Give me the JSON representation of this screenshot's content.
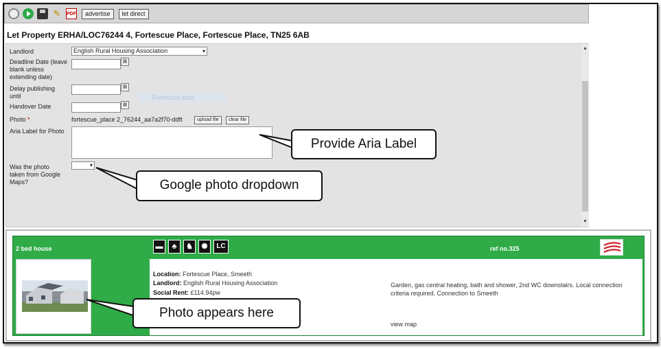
{
  "toolbar": {
    "icons": [
      "back-circle-icon",
      "go-icon",
      "save-icon",
      "edit-icon",
      "pdf-icon"
    ],
    "advertise_label": "advertise",
    "let_direct_label": "let direct"
  },
  "page_title": "Let  Property ERHA/LOC76244 4, Fortescue Place, Fortescue Place, TN25 6AB",
  "form": {
    "landlord_label": "Landlord",
    "landlord_value": "English Rural Housing Association",
    "deadline_label_lines": [
      "Deadline Date (leave",
      "blank unless",
      "extending date)"
    ],
    "delay_label_lines": [
      "Delay publishing",
      "until"
    ],
    "handover_label": "Handover Date",
    "ghost_tag": "Fortescue local",
    "photo_label": "Photo",
    "photo_required": "*",
    "photo_filename": "fortescue_place 2_76244_aa7a2f70-ddft",
    "upload_label": "upload file",
    "clear_label": "clear file",
    "aria_label": "Aria Label for Photo",
    "google_label_lines": [
      "Was the photo",
      "taken from Google",
      "Maps?"
    ]
  },
  "callouts": {
    "aria": "Provide Aria Label",
    "google": "Google photo dropdown",
    "photo": "Photo appears here"
  },
  "listing": {
    "title": "2 bed house",
    "ref": "ref no.325",
    "features": [
      "bed-icon",
      "garden-icon",
      "pet-icon",
      "heating-icon",
      "lc-icon"
    ],
    "feature_text": "LC",
    "location_label": "Location:",
    "location_value": " Fortescue Place, Smeeth",
    "landlord_label": "Landlord:",
    "landlord_value": " English Rural Housing Association",
    "rent_label": "Social Rent:",
    "rent_value": " £114.94pw",
    "description": "Garden, gas central heating, bath and shower, 2nd WC downstairs. Local connection criteria required. Connection to Smeeth",
    "view_map": "view map"
  },
  "colors": {
    "listing_green": "#2fab48",
    "required_red": "#cc0000"
  }
}
